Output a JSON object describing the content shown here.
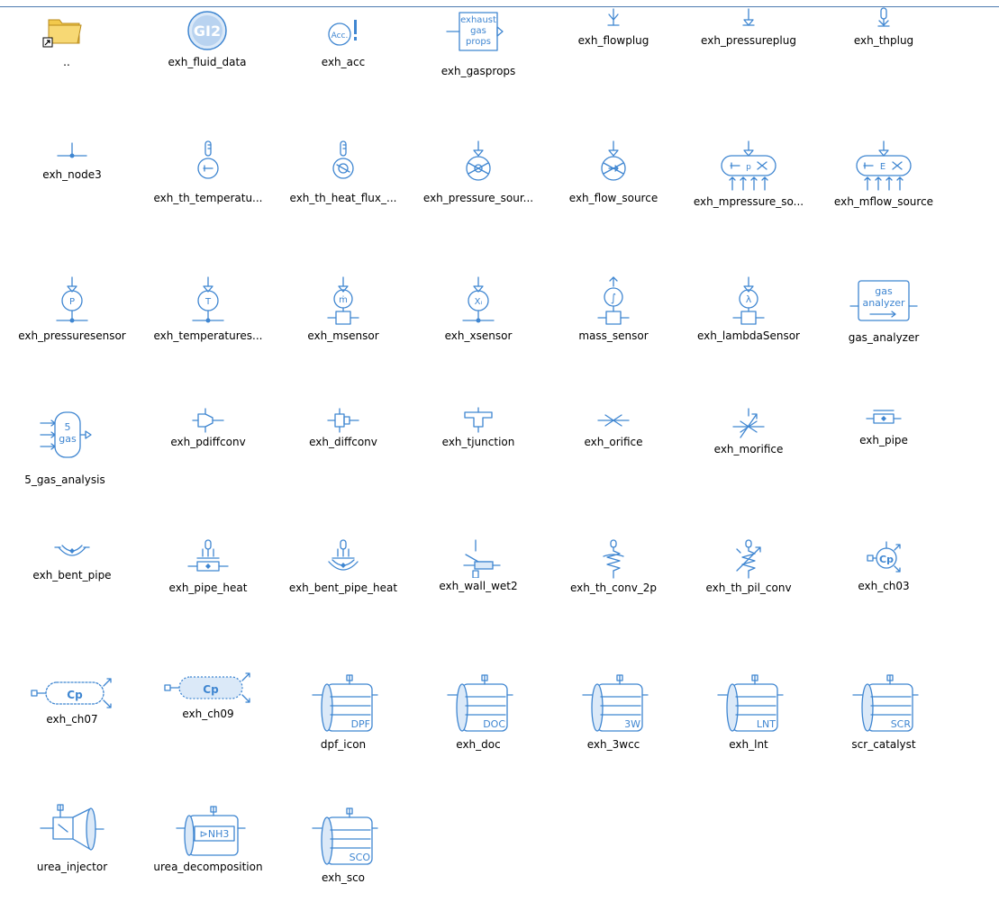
{
  "library": {
    "items": [
      {
        "label": "..",
        "icon": "parent-folder-icon"
      },
      {
        "label": "exh_fluid_data",
        "icon": "fluid-data-icon",
        "icon_text": "GI2"
      },
      {
        "label": "exh_acc",
        "icon": "acc-icon",
        "icon_text": "Acc."
      },
      {
        "label": "exh_gasprops",
        "icon": "gasprops-icon",
        "icon_text": [
          "exhaust",
          "gas",
          "props"
        ]
      },
      {
        "label": "exh_flowplug",
        "icon": "flowplug-icon"
      },
      {
        "label": "exh_pressureplug",
        "icon": "pressureplug-icon"
      },
      {
        "label": "exh_thplug",
        "icon": "thplug-icon"
      },
      {
        "label": "exh_node3",
        "icon": "node3-icon"
      },
      {
        "label": "exh_th_temperatu...",
        "icon": "th-temperature-icon"
      },
      {
        "label": "exh_th_heat_flux_...",
        "icon": "th-heat-flux-icon"
      },
      {
        "label": "exh_pressure_sour...",
        "icon": "pressure-source-icon"
      },
      {
        "label": "exh_flow_source",
        "icon": "flow-source-icon"
      },
      {
        "label": "exh_mpressure_so...",
        "icon": "mpressure-source-icon"
      },
      {
        "label": "exh_mflow_source",
        "icon": "mflow-source-icon"
      },
      {
        "label": "exh_pressuresensor",
        "icon": "pressure-sensor-icon",
        "icon_text": "P"
      },
      {
        "label": "exh_temperatures...",
        "icon": "temperature-sensor-icon",
        "icon_text": "T"
      },
      {
        "label": "exh_msensor",
        "icon": "msensor-icon",
        "icon_text": "ṁ"
      },
      {
        "label": "exh_xsensor",
        "icon": "xsensor-icon",
        "icon_text": "Xᵢ"
      },
      {
        "label": "mass_sensor",
        "icon": "mass-sensor-icon",
        "icon_text": "∫"
      },
      {
        "label": "exh_lambdaSensor",
        "icon": "lambda-sensor-icon",
        "icon_text": "λ"
      },
      {
        "label": "gas_analyzer",
        "icon": "gas-analyzer-icon",
        "icon_text": [
          "gas",
          "analyzer"
        ]
      },
      {
        "label": "5_gas_analysis",
        "icon": "five-gas-analysis-icon",
        "icon_text": [
          "5",
          "gas"
        ]
      },
      {
        "label": "exh_pdiffconv",
        "icon": "pdiffconv-icon"
      },
      {
        "label": "exh_diffconv",
        "icon": "diffconv-icon"
      },
      {
        "label": "exh_tjunction",
        "icon": "tjunction-icon"
      },
      {
        "label": "exh_orifice",
        "icon": "orifice-icon"
      },
      {
        "label": "exh_morifice",
        "icon": "morifice-icon"
      },
      {
        "label": "exh_pipe",
        "icon": "pipe-icon"
      },
      {
        "label": "exh_bent_pipe",
        "icon": "bent-pipe-icon"
      },
      {
        "label": "exh_pipe_heat",
        "icon": "pipe-heat-icon"
      },
      {
        "label": "exh_bent_pipe_heat",
        "icon": "bent-pipe-heat-icon"
      },
      {
        "label": "exh_wall_wet2",
        "icon": "wall-wet-icon"
      },
      {
        "label": "exh_th_conv_2p",
        "icon": "th-conv-icon"
      },
      {
        "label": "exh_th_pil_conv",
        "icon": "th-pil-conv-icon"
      },
      {
        "label": "exh_ch03",
        "icon": "chamber-3-icon",
        "icon_text": "Cp"
      },
      {
        "label": "exh_ch07",
        "icon": "chamber-7-icon",
        "icon_text": "Cp"
      },
      {
        "label": "exh_ch09",
        "icon": "chamber-9-icon",
        "icon_text": "Cp"
      },
      {
        "label": "dpf_icon",
        "icon": "dpf-icon",
        "icon_text": "DPF"
      },
      {
        "label": "exh_doc",
        "icon": "doc-icon",
        "icon_text": "DOC"
      },
      {
        "label": "exh_3wcc",
        "icon": "three-way-catalyst-icon",
        "icon_text": "3W"
      },
      {
        "label": "exh_lnt",
        "icon": "lnt-icon",
        "icon_text": "LNT"
      },
      {
        "label": "scr_catalyst",
        "icon": "scr-catalyst-icon",
        "icon_text": "SCR"
      },
      {
        "label": "urea_injector",
        "icon": "urea-injector-icon"
      },
      {
        "label": "urea_decomposition",
        "icon": "urea-decomposition-icon",
        "icon_text": "⊳NH3"
      },
      {
        "label": "exh_sco",
        "icon": "sco-icon",
        "icon_text": "SCO"
      }
    ]
  },
  "colors": {
    "icon_stroke": "#3f86d1",
    "icon_fill_light": "#dbe9f8",
    "folder": "#f2c94c",
    "top_border": "#4d7bb0"
  }
}
